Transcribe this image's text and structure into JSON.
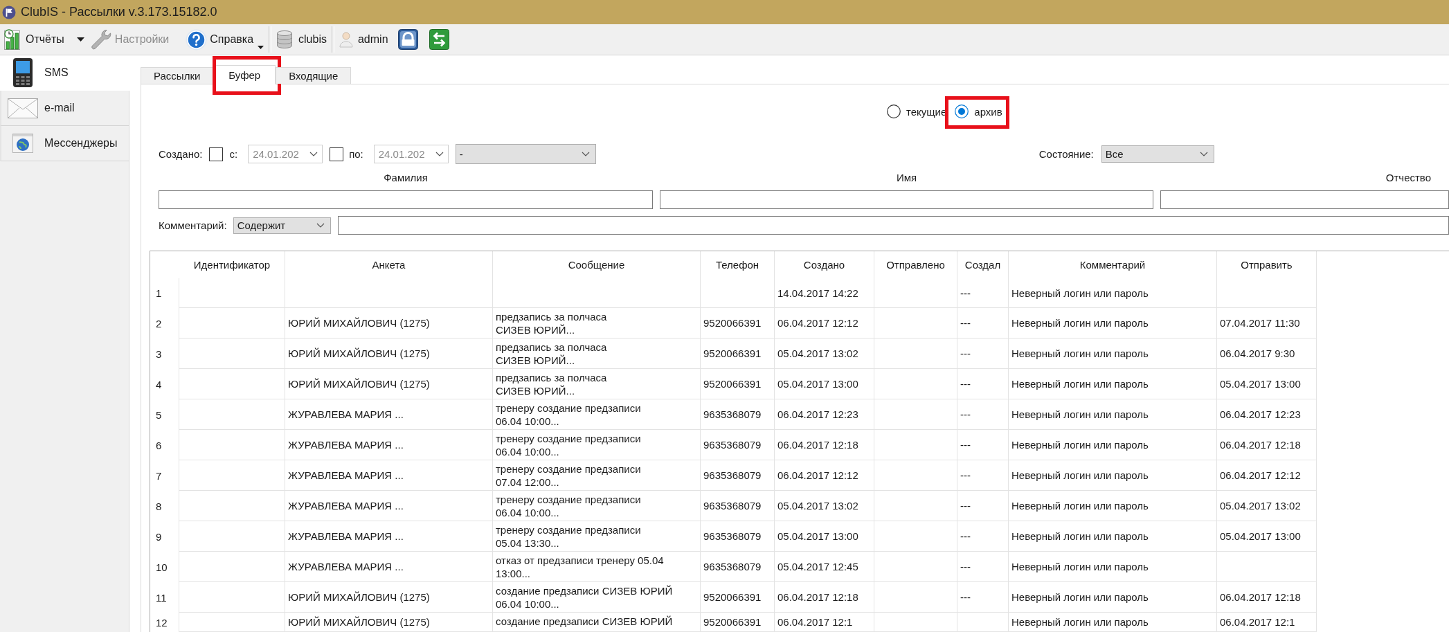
{
  "window": {
    "title": "ClubIS - Рассылки v.3.173.15182.0"
  },
  "toolbar": {
    "reports": {
      "label": "Отчёты"
    },
    "settings": {
      "label": "Настройки",
      "disabled": true
    },
    "help": {
      "label": "Справка"
    },
    "database": {
      "label": "clubis"
    },
    "user": {
      "label": "admin"
    }
  },
  "sidebar": {
    "items": [
      {
        "label": "SMS",
        "selected": true
      },
      {
        "label": "e-mail",
        "selected": false
      },
      {
        "label": "Мессенджеры",
        "selected": false
      }
    ]
  },
  "tabs": [
    {
      "label": "Рассылки",
      "selected": false,
      "highlighted": false
    },
    {
      "label": "Буфер",
      "selected": true,
      "highlighted": true
    },
    {
      "label": "Входящие",
      "selected": false,
      "highlighted": false
    }
  ],
  "mode_radios": [
    {
      "label": "текущие",
      "selected": false,
      "highlighted": false
    },
    {
      "label": "архив",
      "selected": true,
      "highlighted": true
    }
  ],
  "filters": {
    "created": {
      "label": "Создано:",
      "from": {
        "label": "с:",
        "checked": false,
        "value": "24.01.202",
        "disabled": true
      },
      "to": {
        "label": "по:",
        "checked": false,
        "value": "24.01.202",
        "disabled": true
      },
      "period": {
        "value": "-"
      }
    },
    "state": {
      "label": "Состояние:",
      "value": "Все"
    },
    "name_fields": [
      {
        "label": "Фамилия"
      },
      {
        "label": "Имя"
      },
      {
        "label": "Отчество"
      }
    ],
    "comment": {
      "label": "Комментарий:",
      "mode": "Содержит"
    }
  },
  "table": {
    "columns": [
      "Идентификатор",
      "Анкета",
      "Сообщение",
      "Телефон",
      "Создано",
      "Отправлено",
      "Создал",
      "Комментарий",
      "Отправить"
    ],
    "rows": [
      {
        "number": "1",
        "cells": [
          null,
          null,
          null,
          null,
          "14.04.2017 14:22",
          null,
          "---",
          "Неверный логин или пароль",
          null
        ]
      },
      {
        "number": "2",
        "cells": [
          null,
          "ЮРИЙ МИХАЙЛОВИЧ (1275)",
          "предзапись за полчаса\nСИЗЕВ ЮРИЙ...",
          "9520066391",
          "06.04.2017 12:12",
          null,
          "---",
          "Неверный логин или пароль",
          "07.04.2017 11:30"
        ]
      },
      {
        "number": "3",
        "cells": [
          null,
          "ЮРИЙ МИХАЙЛОВИЧ (1275)",
          "предзапись за полчаса\nСИЗЕВ ЮРИЙ...",
          "9520066391",
          "05.04.2017 13:02",
          null,
          "---",
          "Неверный логин или пароль",
          "06.04.2017 9:30"
        ]
      },
      {
        "number": "4",
        "cells": [
          null,
          "ЮРИЙ МИХАЙЛОВИЧ (1275)",
          "предзапись за полчаса\nСИЗЕВ ЮРИЙ...",
          "9520066391",
          "05.04.2017 13:00",
          null,
          "---",
          "Неверный логин или пароль",
          "05.04.2017 13:00"
        ]
      },
      {
        "number": "5",
        "cells": [
          null,
          "ЖУРАВЛЕВА МАРИЯ ...",
          "тренеру создание предзаписи\n06.04 10:00...",
          "9635368079",
          "06.04.2017 12:23",
          null,
          "---",
          "Неверный логин или пароль",
          "06.04.2017 12:23"
        ]
      },
      {
        "number": "6",
        "cells": [
          null,
          "ЖУРАВЛЕВА МАРИЯ ...",
          "тренеру создание предзаписи\n06.04 10:00...",
          "9635368079",
          "06.04.2017 12:18",
          null,
          "---",
          "Неверный логин или пароль",
          "06.04.2017 12:18"
        ]
      },
      {
        "number": "7",
        "cells": [
          null,
          "ЖУРАВЛЕВА МАРИЯ ...",
          "тренеру создание предзаписи\n07.04 12:00...",
          "9635368079",
          "06.04.2017 12:12",
          null,
          "---",
          "Неверный логин или пароль",
          "06.04.2017 12:12"
        ]
      },
      {
        "number": "8",
        "cells": [
          null,
          "ЖУРАВЛЕВА МАРИЯ ...",
          "тренеру создание предзаписи\n06.04 10:00...",
          "9635368079",
          "05.04.2017 13:02",
          null,
          "---",
          "Неверный логин или пароль",
          "05.04.2017 13:02"
        ]
      },
      {
        "number": "9",
        "cells": [
          null,
          "ЖУРАВЛЕВА МАРИЯ ...",
          "тренеру создание предзаписи\n05.04 13:30...",
          "9635368079",
          "05.04.2017 13:00",
          null,
          "---",
          "Неверный логин или пароль",
          "05.04.2017 13:00"
        ]
      },
      {
        "number": "10",
        "cells": [
          null,
          "ЖУРАВЛЕВА МАРИЯ ...",
          "отказ от предзаписи тренеру 05.04\n13:00...",
          "9635368079",
          "05.04.2017 12:45",
          null,
          "---",
          "Неверный логин или пароль",
          null
        ]
      },
      {
        "number": "11",
        "cells": [
          null,
          "ЮРИЙ МИХАЙЛОВИЧ (1275)",
          "создание предзаписи СИЗЕВ ЮРИЙ\n06.04 10:00...",
          "9520066391",
          "06.04.2017 12:18",
          null,
          "---",
          "Неверный логин или пароль",
          "06.04.2017 12:18"
        ]
      },
      {
        "number": "12",
        "cells": [
          null,
          "ЮРИЙ МИХАЙЛОВИЧ (1275)",
          "создание предзаписи СИЗЕВ ЮРИЙ",
          "9520066391",
          "06.04.2017 12:1",
          null,
          null,
          "Неверный логин или пароль",
          "06.04.2017 12:1"
        ]
      }
    ]
  }
}
